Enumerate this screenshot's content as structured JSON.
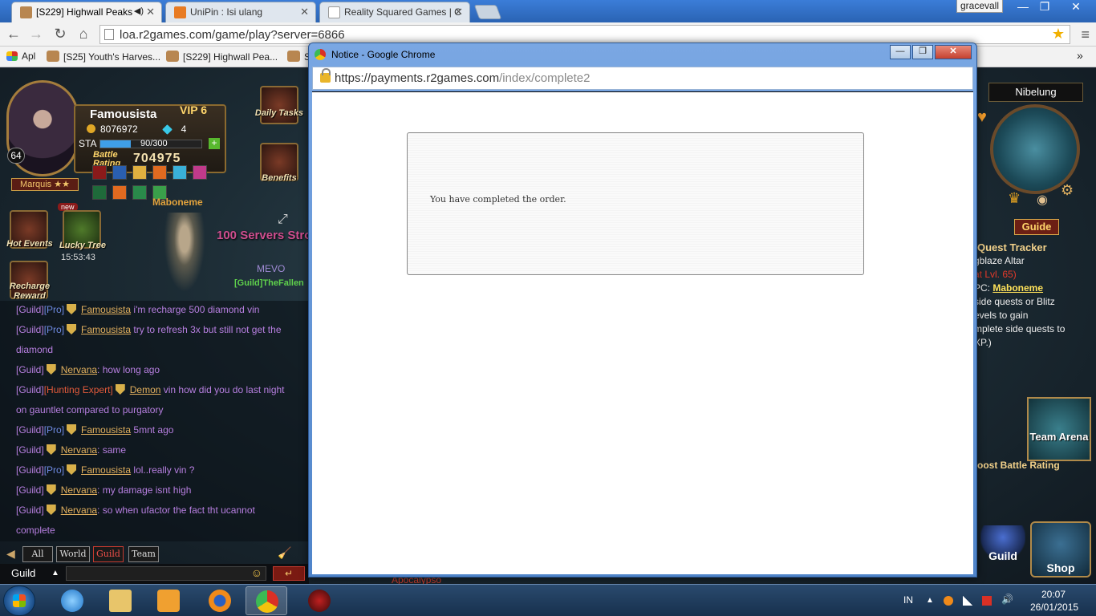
{
  "browser": {
    "tabs": [
      {
        "label": "[S229] Highwall Peaks",
        "audio": "◀)",
        "active": true
      },
      {
        "label": "UniPin : Isi ulang",
        "active": false
      },
      {
        "label": "Reality Squared Games | C",
        "active": false
      }
    ],
    "user": "gracevall",
    "url": "loa.r2games.com/game/play?server=6866",
    "bookmarks": [
      {
        "label": "Apl",
        "icon": "apps-grid-icon"
      },
      {
        "label": "[S25] Youth's Harves...",
        "icon": "game-favicon"
      },
      {
        "label": "[S229] Highwall Pea...",
        "icon": "game-favicon"
      },
      {
        "label": "S",
        "icon": "game-favicon"
      }
    ],
    "colors": {
      "tabstrip": "#2d6cc0",
      "star": "#f1b000"
    }
  },
  "game": {
    "player": {
      "name": "Famousista",
      "vip": "VIP 6",
      "level": "64",
      "gold": "8076972",
      "diamonds": "4",
      "sta_label": "STA",
      "sta_value": "90/300",
      "sta_fraction": 0.3,
      "battle_rating_label": "Battle Rating",
      "battle_rating": "704975",
      "title": "Marquis ★★"
    },
    "buttons": {
      "daily_tasks": "Daily Tasks",
      "benefits": "Benefits",
      "hot_events": "Hot Events",
      "lucky_tree": "Lucky Tree",
      "lucky_tree_timer": "15:53:43",
      "recharge_reward": "Recharge Reward",
      "new_badge": "new"
    },
    "scene": {
      "npc_name": "Maboneme",
      "banner": "100 Servers Stro",
      "mevo": "MEVO",
      "guild_fallen": "[Guild]TheFallen",
      "apoc": "Apocalypso"
    },
    "chat": {
      "lines": [
        {
          "channel": "[Guild]",
          "rank": "[Pro]",
          "who": "Famousista",
          "msg": " i'm recharge 500 diamond vin"
        },
        {
          "channel": "[Guild]",
          "rank": "[Pro]",
          "who": "Famousista",
          "msg": " try to refresh 3x but still not get the"
        },
        {
          "channel": "",
          "rank": "",
          "who": "",
          "msg": "diamond"
        },
        {
          "channel": "[Guild]",
          "rank": "",
          "who": "Nervana",
          "msg": ": how long ago"
        },
        {
          "channel": "[Guild]",
          "rank": "[Hunting Expert]",
          "who": "Demon",
          "msg": " vin how did you do last night"
        },
        {
          "channel": "",
          "rank": "",
          "who": "",
          "msg": "on gauntlet compared to purgatory"
        },
        {
          "channel": "[Guild]",
          "rank": "[Pro]",
          "who": "Famousista",
          "msg": " 5mnt ago"
        },
        {
          "channel": "[Guild]",
          "rank": "",
          "who": "Nervana",
          "msg": ": same"
        },
        {
          "channel": "[Guild]",
          "rank": "[Pro]",
          "who": "Famousista",
          "msg": " lol..really vin ?"
        },
        {
          "channel": "[Guild]",
          "rank": "",
          "who": "Nervana",
          "msg": ": my damage isnt high"
        },
        {
          "channel": "[Guild]",
          "rank": "",
          "who": "Nervana",
          "msg": ": so when ufactor the fact tht ucannot"
        },
        {
          "channel": "",
          "rank": "",
          "who": "",
          "msg": "complete"
        }
      ],
      "tabs": [
        "All",
        "World",
        "Guild",
        "Team"
      ],
      "selected_tab": "Guild",
      "channel": "Guild",
      "send_symbol": "↵"
    },
    "right": {
      "server": "Nibelung",
      "guide": "Guide",
      "quest_tracker": "Quest Tracker",
      "quest_name": "gblaze Altar",
      "quest_req": "at Lvl. 65)",
      "npc_prefix": "PC: ",
      "npc": "Maboneme",
      "hint1": " side quests or Blitz",
      "hint2": "evels to gain",
      "hint3": "mplete side quests to",
      "hint4": "XP.)",
      "team_arena": "Team Arena",
      "boost": "oost Battle Rating",
      "guild": "Guild",
      "shop": "Shop"
    }
  },
  "popup": {
    "title": "Notice - Google Chrome",
    "url_host": "https://payments.r2games.com",
    "url_path": "/index/complete2",
    "message": "You have completed the order."
  },
  "taskbar": {
    "lang": "IN",
    "time": "20:07",
    "date": "26/01/2015",
    "apps": [
      "ie",
      "explorer",
      "media-player",
      "firefox",
      "chrome",
      "game"
    ]
  }
}
